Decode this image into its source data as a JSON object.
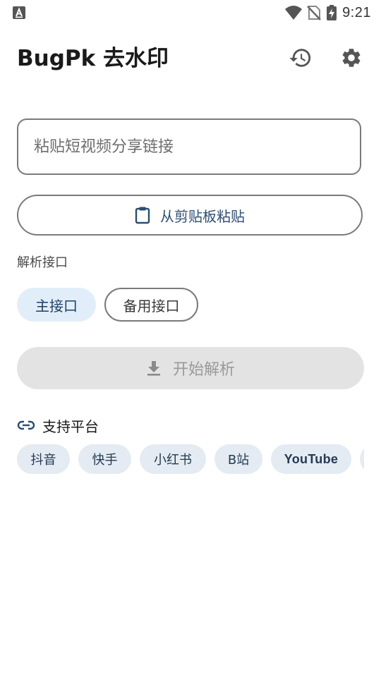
{
  "status_bar": {
    "notification_icon": "a-square-icon",
    "time": "9:21"
  },
  "app_bar": {
    "title": "BugPk 去水印",
    "history_icon": "history-icon",
    "settings_icon": "gear-icon"
  },
  "link_input": {
    "value": "",
    "placeholder": "粘贴短视频分享链接"
  },
  "paste_button": {
    "label": "从剪贴板粘贴",
    "icon": "clipboard-icon"
  },
  "api_section": {
    "label": "解析接口",
    "options": [
      {
        "label": "主接口",
        "selected": true
      },
      {
        "label": "备用接口",
        "selected": false
      }
    ]
  },
  "parse_button": {
    "label": "开始解析",
    "icon": "download-icon",
    "enabled": false
  },
  "platforms": {
    "title": "支持平台",
    "icon": "link-icon",
    "items": [
      "抖音",
      "快手",
      "小红书",
      "B站",
      "YouTube",
      ""
    ]
  },
  "colors": {
    "accent": "#2b4d73",
    "chip_selected_bg": "#e1eefa",
    "platform_chip_bg": "#e4ebf2",
    "disabled_bg": "#e3e3e3",
    "disabled_text": "#9a9a9a",
    "outline": "#7a7a7a"
  }
}
